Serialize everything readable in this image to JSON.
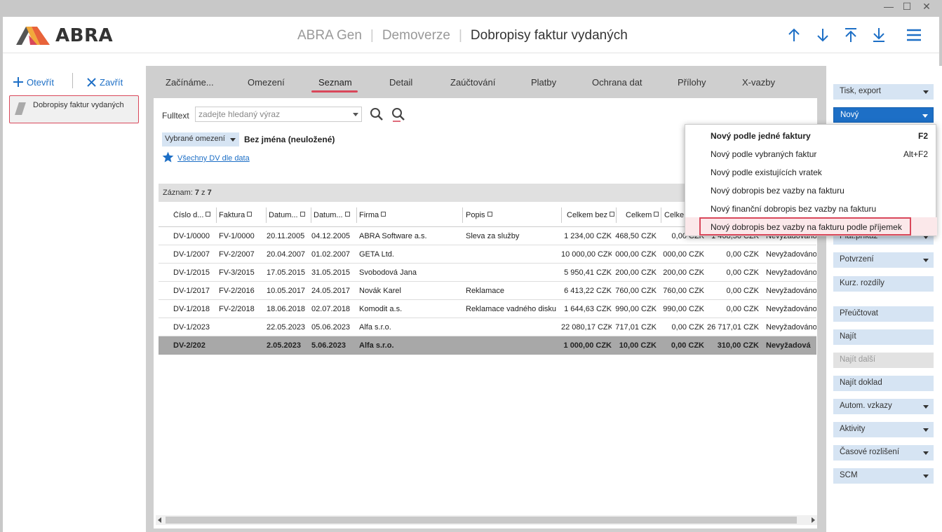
{
  "header": {
    "logo_text": "ABRA",
    "breadcrumbs": [
      "ABRA Gen",
      "Demoverze",
      "Dobropisy faktur vydaných"
    ]
  },
  "left_panel": {
    "open_label": "Otevřít",
    "close_label": "Zavřít",
    "doc_tab_label": "Dobropisy faktur vydaných"
  },
  "tabs": [
    "Začínáme...",
    "Omezení",
    "Seznam",
    "Detail",
    "Zaúčtování",
    "Platby",
    "Ochrana dat",
    "Přílohy",
    "X-vazby"
  ],
  "active_tab": "Seznam",
  "search": {
    "label": "Fulltext",
    "placeholder": "zadejte hledaný výraz"
  },
  "filter": {
    "button_label": "Vybrané omezení",
    "name": "Bez jména (neuložené)",
    "link": "Všechny DV dle data"
  },
  "records": {
    "label": "Záznam:",
    "current": "7",
    "of": "z",
    "total": "7"
  },
  "table": {
    "columns": [
      "Číslo d...",
      "Faktura",
      "Datum...",
      "Datum...",
      "Firma",
      "Popis",
      "Celkem bez",
      "Celkem",
      "Celke"
    ],
    "rows": [
      [
        "DV-1/0000",
        "FV-1/0000",
        "20.11.2005",
        "04.12.2005",
        "ABRA Software a.s.",
        "Sleva za služby",
        "1 234,00 CZK",
        "468,50 CZK",
        "0,00 CZK",
        "1 468,50 CZK",
        "Nevyžadováno"
      ],
      [
        "DV-1/2007",
        "FV-2/2007",
        "20.04.2007",
        "01.02.2007",
        "GETA Ltd.",
        "",
        "10 000,00 CZK",
        "000,00 CZK",
        "000,00 CZK",
        "0,00 CZK",
        "Nevyžadováno"
      ],
      [
        "DV-1/2015",
        "FV-3/2015",
        "17.05.2015",
        "31.05.2015",
        "Svobodová Jana",
        "",
        "5 950,41 CZK",
        "200,00 CZK",
        "200,00 CZK",
        "0,00 CZK",
        "Nevyžadováno"
      ],
      [
        "DV-1/2017",
        "FV-2/2016",
        "10.05.2017",
        "24.05.2017",
        "Novák Karel",
        "Reklamace",
        "6 413,22 CZK",
        "760,00 CZK",
        "760,00 CZK",
        "0,00 CZK",
        "Nevyžadováno"
      ],
      [
        "DV-1/2018",
        "FV-2/2018",
        "18.06.2018",
        "02.07.2018",
        "Komodit a.s.",
        "Reklamace vadného disku",
        "1 644,63 CZK",
        "990,00 CZK",
        "990,00 CZK",
        "0,00 CZK",
        "Nevyžadováno"
      ],
      [
        "DV-1/2023",
        "",
        "22.05.2023",
        "05.06.2023",
        "Alfa s.r.o.",
        "",
        "22 080,17 CZK",
        "717,01 CZK",
        "0,00 CZK",
        "26 717,01 CZK",
        "Nevyžadováno"
      ],
      [
        "DV-2/202",
        "",
        "2.05.2023",
        "5.06.2023",
        "Alfa s.r.o.",
        "",
        "1 000,00 CZK",
        "10,00 CZK",
        "0,00 CZK",
        "310,00 CZK",
        "Nevyžadová"
      ]
    ]
  },
  "right_panel": {
    "buttons": [
      {
        "label": "Tisk, export",
        "dropdown": true
      },
      {
        "label": "Nový",
        "dropdown": true
      },
      {
        "label": "Plat.příkaz",
        "dropdown": true
      },
      {
        "label": "Potvrzení",
        "dropdown": true
      },
      {
        "label": "Kurz. rozdíly",
        "dropdown": false
      },
      {
        "label": "Přeúčtovat",
        "dropdown": false
      },
      {
        "label": "Najít",
        "dropdown": false
      },
      {
        "label": "Najít další",
        "dropdown": false
      },
      {
        "label": "Najít doklad",
        "dropdown": false
      },
      {
        "label": "Autom. vzkazy",
        "dropdown": true
      },
      {
        "label": "Aktivity",
        "dropdown": true
      },
      {
        "label": "Časové rozlišení",
        "dropdown": true
      },
      {
        "label": "SCM",
        "dropdown": true
      }
    ]
  },
  "menu": {
    "items": [
      {
        "label": "Nový podle jedné faktury",
        "shortcut": "F2",
        "bold": true
      },
      {
        "label": "Nový podle vybraných faktur",
        "shortcut": "Alt+F2",
        "bold": false
      },
      {
        "label": "Nový podle existujících vratek",
        "shortcut": "",
        "bold": false
      },
      {
        "label": "Nový dobropis bez vazby na fakturu",
        "shortcut": "",
        "bold": false
      },
      {
        "label": "Nový finanční dobropis bez vazby na fakturu",
        "shortcut": "",
        "bold": false
      },
      {
        "label": "Nový dobropis bez vazby na fakturu podle příjemek",
        "shortcut": "",
        "bold": false
      }
    ],
    "highlighted_index": 5
  },
  "colors": {
    "accent": "#1d6fc6",
    "highlight": "#d9475a",
    "button_bg": "#d6e4f3"
  }
}
